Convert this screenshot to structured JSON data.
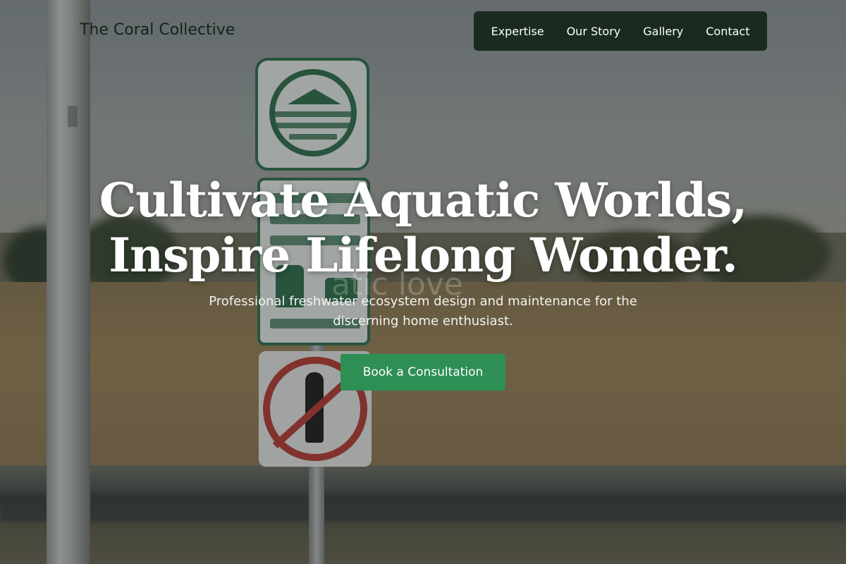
{
  "header": {
    "brand": "The Coral Collective",
    "nav": [
      {
        "label": "Expertise"
      },
      {
        "label": "Our Story"
      },
      {
        "label": "Gallery"
      },
      {
        "label": "Contact"
      }
    ]
  },
  "hero": {
    "headline_line1": "Cultivate Aquatic Worlds,",
    "headline_line2": "Inspire Lifelong Wonder.",
    "ghost_text": "atic love",
    "subhead_line1": "Professional freshwater ecosystem design and maintenance for the",
    "subhead_line2": "discerning home enthusiast.",
    "cta_label": "Book a Consultation"
  },
  "colors": {
    "nav_bg": "#1a2a21",
    "cta_bg": "#2e8f55",
    "brand_text": "#13231a",
    "headline_text": "#ffffff"
  },
  "icons": {
    "sign_top": "conservation-fund-sign-icon",
    "sign_middle": "leash-sign-icon",
    "sign_bottom": "no-golf-sign-icon"
  }
}
